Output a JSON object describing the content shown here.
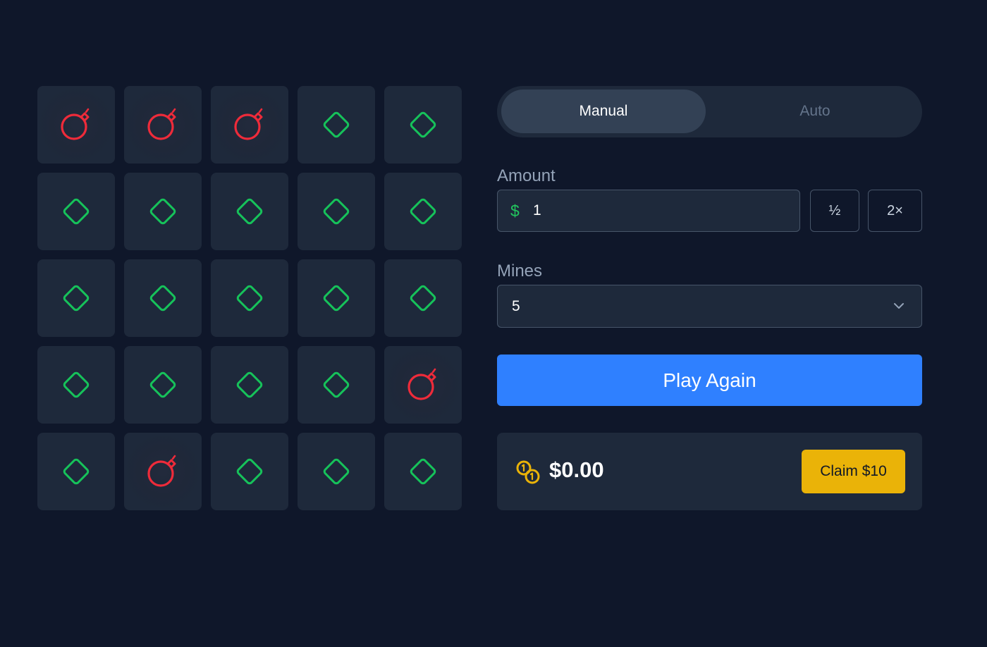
{
  "grid": {
    "rows": 5,
    "cols": 5,
    "tiles": [
      "bomb",
      "bomb",
      "bomb",
      "gem",
      "gem",
      "gem",
      "gem",
      "gem",
      "gem",
      "gem",
      "gem",
      "gem",
      "gem",
      "gem",
      "gem",
      "gem",
      "gem",
      "gem",
      "gem",
      "bomb",
      "gem",
      "bomb",
      "gem",
      "gem",
      "gem"
    ],
    "icons": {
      "bomb": "bomb-icon",
      "gem": "diamond-icon"
    },
    "colors": {
      "bomb": "#ef2b3a",
      "gem": "#16c25a"
    }
  },
  "mode": {
    "manual_label": "Manual",
    "auto_label": "Auto",
    "selected": "Manual"
  },
  "amount": {
    "label": "Amount",
    "currency_symbol": "$",
    "value": "1",
    "half_label": "½",
    "double_label": "2×"
  },
  "mines": {
    "label": "Mines",
    "value": "5",
    "icon": "chevron-down-icon"
  },
  "play": {
    "label": "Play Again",
    "color": "#2f80ff"
  },
  "balance": {
    "icon": "coins-icon",
    "value": "$0.00",
    "claim_label": "Claim $10",
    "claim_color": "#eab308"
  }
}
